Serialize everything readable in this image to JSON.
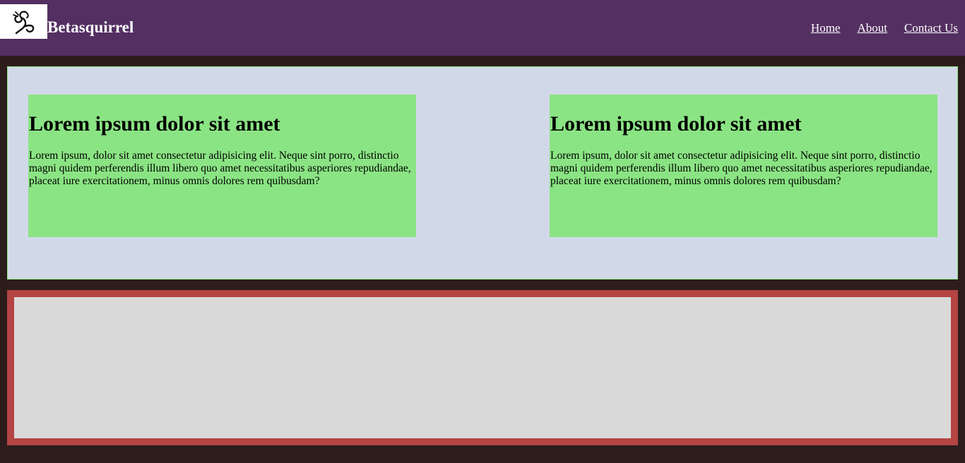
{
  "header": {
    "brand": "Betasquirrel",
    "logo_icon": "squirrel-logo-icon",
    "nav": [
      "Home",
      "About",
      "Contact Us"
    ]
  },
  "cards": [
    {
      "title": "Lorem ipsum dolor sit amet",
      "body": "Lorem ipsum, dolor sit amet consectetur adipisicing elit. Neque sint porro, distinctio magni quidem perferendis illum libero quo amet necessitatibus asperiores repudiandae, placeat iure exercitationem, minus omnis dolores rem quibusdam?"
    },
    {
      "title": "Lorem ipsum dolor sit amet",
      "body": "Lorem ipsum, dolor sit amet consectetur adipisicing elit. Neque sint porro, distinctio magni quidem perferendis illum libero quo amet necessitatibus asperiores repudiandae, placeat iure exercitationem, minus omnis dolores rem quibusdam?"
    }
  ],
  "colors": {
    "header_bg": "#532f62",
    "page_bg": "#2d1c1c",
    "panel_bg": "#d1d9e8",
    "card_bg": "#8be484",
    "footer_border": "#b54444",
    "footer_bg": "#d9d9d9"
  }
}
